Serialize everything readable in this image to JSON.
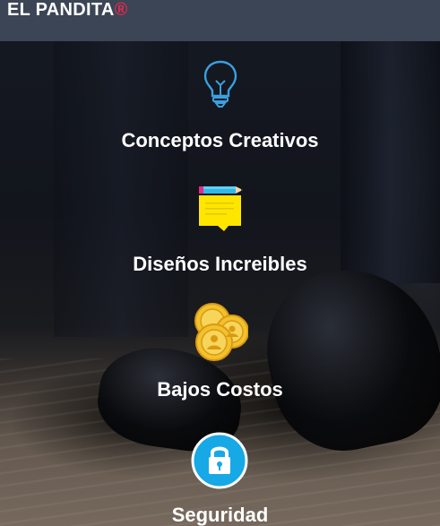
{
  "header": {
    "brand": "EL PANDITA",
    "registered_mark": "®"
  },
  "features": [
    {
      "icon": "lightbulb-icon",
      "label": "Conceptos Creativos"
    },
    {
      "icon": "note-pencil-icon",
      "label": "Diseños Increibles"
    },
    {
      "icon": "coins-icon",
      "label": "Bajos Costos"
    },
    {
      "icon": "lock-icon",
      "label": "Seguridad"
    }
  ],
  "colors": {
    "header_bg": "#3b4556",
    "brand_text": "#ffffff",
    "registered_mark": "#e8284a",
    "lightbulb_stroke": "#3aa0e0",
    "note_yellow": "#ffe600",
    "pencil_blue": "#2fb8e8",
    "coin_gold": "#f2c12e",
    "lock_circle": "#17a8e6"
  }
}
